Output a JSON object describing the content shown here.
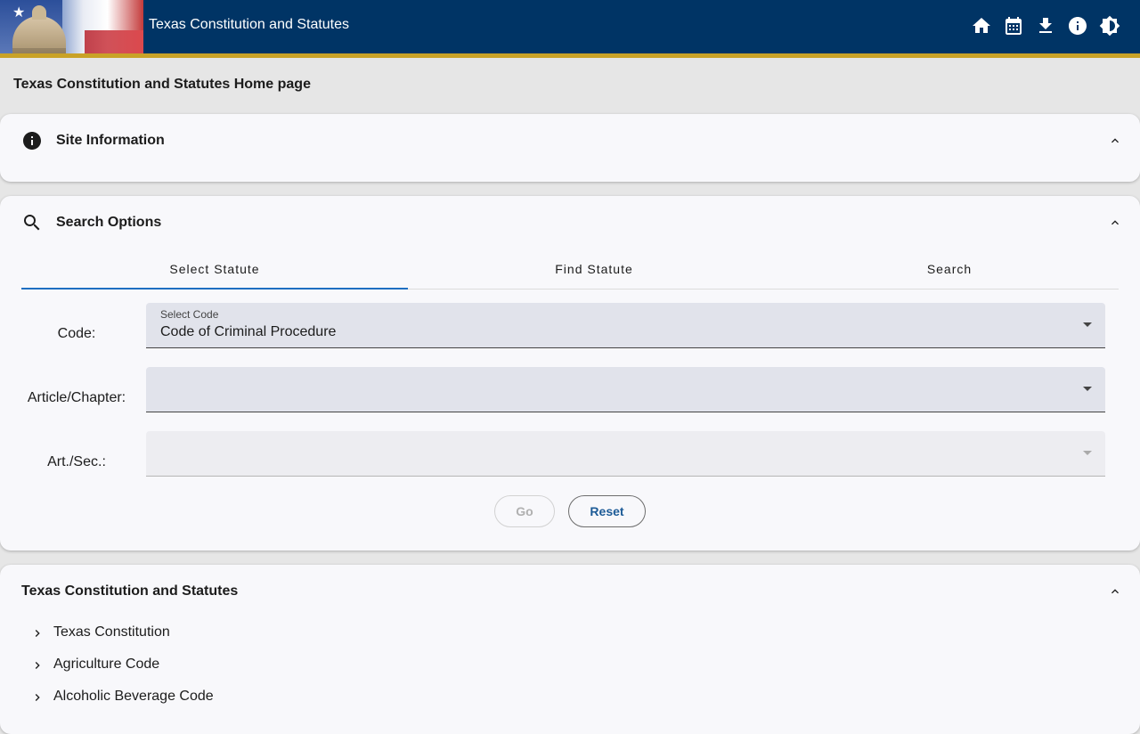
{
  "header": {
    "title": "Texas Constitution and Statutes",
    "icons": [
      "home-icon",
      "calendar-icon",
      "download-icon",
      "info-icon",
      "brightness-icon"
    ]
  },
  "page_title": "Texas Constitution and Statutes Home page",
  "site_info": {
    "title": "Site Information"
  },
  "search_options": {
    "title": "Search Options",
    "tabs": [
      "Select Statute",
      "Find Statute",
      "Search"
    ],
    "active_tab": "Select Statute",
    "code": {
      "label": "Code:",
      "caption": "Select Code",
      "value": "Code of Criminal Procedure"
    },
    "article": {
      "label": "Article/Chapter:",
      "value": ""
    },
    "section": {
      "label": "Art./Sec.:",
      "value": ""
    },
    "go_label": "Go",
    "reset_label": "Reset"
  },
  "statutes": {
    "title": "Texas Constitution and Statutes",
    "items": [
      "Texas Constitution",
      "Agriculture Code",
      "Alcoholic Beverage Code"
    ]
  },
  "colors": {
    "header_bg": "#003465",
    "header_accent": "#c9a227",
    "tab_underline": "#1e6fc1",
    "reset_text": "#1d5b97"
  }
}
